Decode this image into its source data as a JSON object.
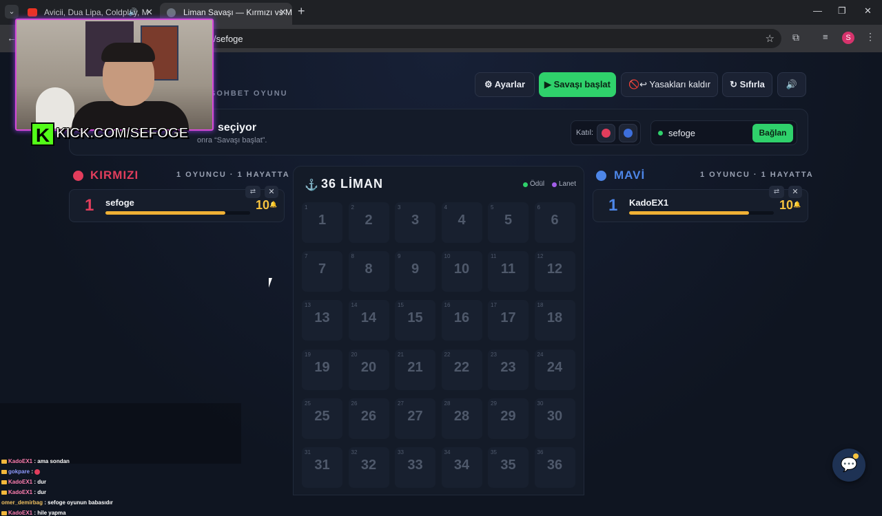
{
  "browser": {
    "tab1_title": "Avicii, Dua Lipa, Coldplay, M",
    "tab2_title": "Liman Savaşı — Kırmızı vs Mavi",
    "url": "/sefoge",
    "profile_initial": "S"
  },
  "toolbar": {
    "settings": "⚙ Ayarlar",
    "start": "▶ Savaşı başlat",
    "ban": "🚫↩ Yasakları kaldır",
    "reset": "↻ Sıfırla",
    "sound": "🔊"
  },
  "subtitle": "SOHBET OYUNU",
  "status": {
    "title": "seçiyor",
    "desc": "onra “Savaşı başlat”.",
    "join_label": "Katıl:",
    "channel": "sefoge",
    "connect": "Bağlan"
  },
  "red": {
    "name": "KIRMIZI",
    "count": "1 OYUNCU · 1 HAYATTA",
    "player": {
      "rank": "1",
      "name": "sefoge",
      "lives": "10",
      "life_fraction": 0.83
    },
    "color": "#e23d5c"
  },
  "blue": {
    "name": "MAVİ",
    "count": "1 OYUNCU · 1 HAYATTA",
    "player": {
      "rank": "1",
      "name": "KadoEX1",
      "lives": "10",
      "life_fraction": 0.83
    },
    "color": "#4d86e8"
  },
  "board": {
    "title": "36 LİMAN",
    "legend_reward": "Ödül",
    "legend_curse": "Lanet",
    "cells": [
      "1",
      "2",
      "3",
      "4",
      "5",
      "6",
      "7",
      "8",
      "9",
      "10",
      "11",
      "12",
      "13",
      "14",
      "15",
      "16",
      "17",
      "18",
      "19",
      "20",
      "21",
      "22",
      "23",
      "24",
      "25",
      "26",
      "27",
      "28",
      "29",
      "30",
      "31",
      "32",
      "33",
      "34",
      "35",
      "36"
    ]
  },
  "overlay": {
    "kick_k": "K",
    "kick_text": "KICK.COM/SEFOGE"
  },
  "chat": [
    {
      "user": "KadoEX1",
      "msg": ": ama sondan"
    },
    {
      "user": "gokpare",
      "msg": ":"
    },
    {
      "user": "KadoEX1",
      "msg": ": dur"
    },
    {
      "user": "KadoEX1",
      "msg": ": dur"
    },
    {
      "user": "omer_demirbag",
      "msg": ": sefoge oyunun babasıdır"
    },
    {
      "user": "KadoEX1",
      "msg": ": hile yapma"
    }
  ],
  "icons": {
    "close": "✕",
    "swap": "⇄",
    "anchor": "⚓",
    "bell": "🔔",
    "chat_bubble": "💬"
  }
}
